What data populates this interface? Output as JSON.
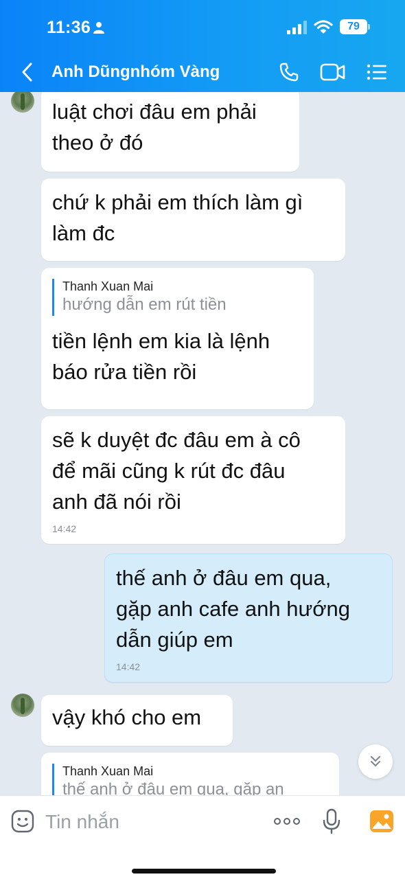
{
  "status_bar": {
    "time": "11:36",
    "battery": "79"
  },
  "header": {
    "title": "Anh Dũngnhóm Vàng",
    "icons": [
      "back-icon",
      "phone-icon",
      "video-icon",
      "menu-list-icon"
    ]
  },
  "messages": [
    {
      "id": 1,
      "sender": "other",
      "text_lines": [
        "luật chơi đâu em phải",
        "theo ở đó"
      ]
    },
    {
      "id": 2,
      "sender": "other",
      "text_lines": [
        "chứ k phải em thích làm gì",
        "làm đc"
      ]
    },
    {
      "id": 3,
      "sender": "other",
      "quote": {
        "name": "Thanh Xuan Mai",
        "text": "hướng dẫn em rút tiền"
      },
      "text_lines": [
        "tiền lệnh em kia là lệnh",
        "báo rửa tiền rồi"
      ]
    },
    {
      "id": 4,
      "sender": "other",
      "text_lines": [
        "sẽ k duyệt đc đâu em à cô",
        "để mãi cũng k rút đc đâu",
        "anh đã nói rồi"
      ],
      "time": "14:42"
    },
    {
      "id": 5,
      "sender": "me",
      "text_lines": [
        "thế anh ở đâu em qua,",
        "gặp anh cafe anh hướng",
        "dẫn giúp em"
      ],
      "time": "14:42"
    },
    {
      "id": 6,
      "sender": "other",
      "text_lines": [
        "vậy khó cho em"
      ]
    },
    {
      "id": 7,
      "sender": "other",
      "quote": {
        "name": "Thanh Xuan Mai",
        "text": "thế anh ở đâu em qua, gặp an"
      }
    }
  ],
  "input": {
    "placeholder": "Tin nhắn"
  },
  "colors": {
    "header_start": "#0a83f8",
    "header_end": "#17a7f0",
    "chat_background": "#e2e9f1",
    "my_bubble": "#d5edfb",
    "other_bubble": "#ffffff",
    "quote_bar": "#1f87e6"
  }
}
